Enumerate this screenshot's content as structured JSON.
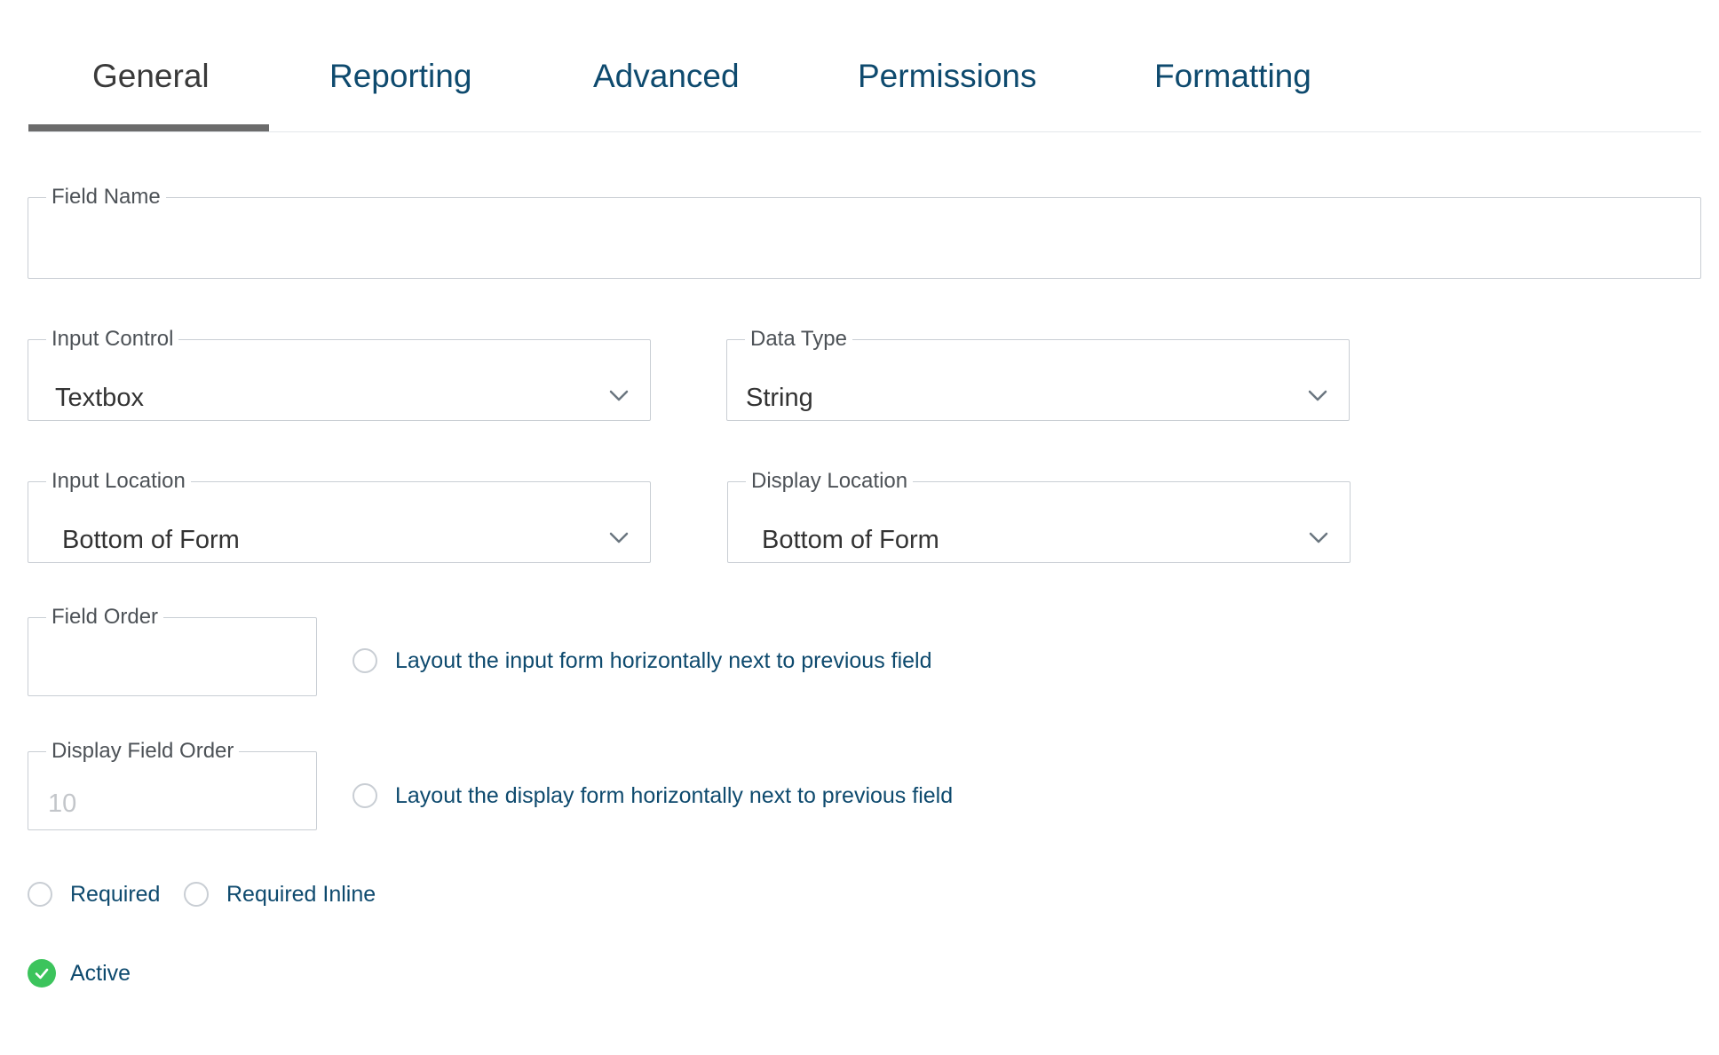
{
  "tabs": [
    {
      "label": "General",
      "active": true
    },
    {
      "label": "Reporting",
      "active": false
    },
    {
      "label": "Advanced",
      "active": false
    },
    {
      "label": "Permissions",
      "active": false
    },
    {
      "label": "Formatting",
      "active": false
    }
  ],
  "form": {
    "field_name": {
      "label": "Field Name",
      "value": ""
    },
    "input_control": {
      "label": "Input Control",
      "value": "Textbox"
    },
    "data_type": {
      "label": "Data Type",
      "value": "String"
    },
    "input_location": {
      "label": "Input Location",
      "value": "Bottom of Form"
    },
    "display_location": {
      "label": "Display Location",
      "value": "Bottom of Form"
    },
    "field_order": {
      "label": "Field Order",
      "value": ""
    },
    "layout_input_horizontal": {
      "label": "Layout the input form horizontally next to previous field",
      "checked": false
    },
    "display_field_order": {
      "label": "Display Field Order",
      "placeholder": "10"
    },
    "layout_display_horizontal": {
      "label": "Layout the display form horizontally next to previous field",
      "checked": false
    },
    "required": {
      "label": "Required",
      "checked": false
    },
    "required_inline": {
      "label": "Required Inline",
      "checked": false
    },
    "active": {
      "label": "Active",
      "checked": true
    }
  },
  "icons": {
    "select_arrow": "chevron-down-icon",
    "active_check": "check-circle-icon"
  },
  "colors": {
    "tab_text": "#0e4a6e",
    "tab_active_text": "#3a3a3a",
    "tab_underline": "#6b6b6b",
    "border": "#c9ced4",
    "active_check": "#3cc45c"
  }
}
